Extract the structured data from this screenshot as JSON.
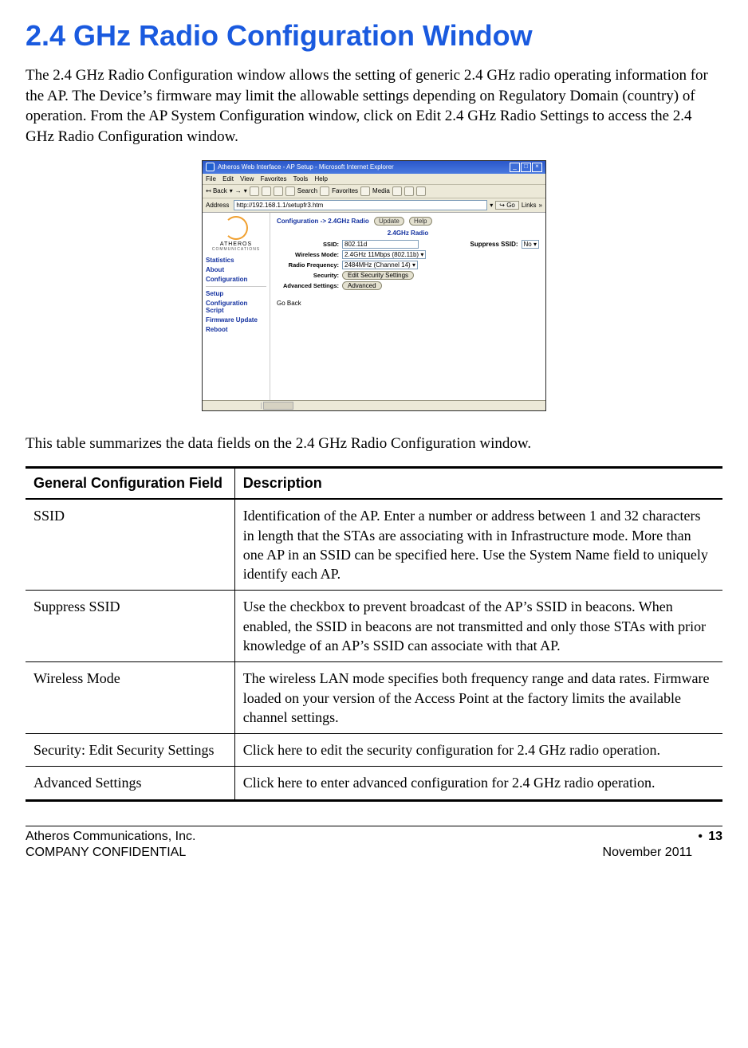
{
  "heading": "2.4 GHz Radio Configuration Window",
  "intro": "The 2.4 GHz Radio Configuration window allows the setting of generic 2.4 GHz radio operating information for the AP. The Device’s firmware may limit the allowable settings depending on Regulatory Domain (country) of operation. From the AP System Configuration window, click on Edit 2.4 GHz Radio Settings to access the 2.4 GHz Radio Configuration window.",
  "table_intro": "This table summarizes the data fields on the 2.4 GHz Radio Configuration window.",
  "table": {
    "headers": {
      "field": "General Configuration Field",
      "desc": "Description"
    },
    "rows": [
      {
        "field": "SSID",
        "desc": "Identification of the AP. Enter a number or address between 1 and 32 characters in length that the STAs are associating with in Infrastructure mode. More than one AP in an SSID can be specified here. Use the System Name field to uniquely identify each AP."
      },
      {
        "field": "Suppress SSID",
        "desc": "Use the checkbox to prevent broadcast of the AP’s SSID in beacons. When enabled, the SSID in beacons are not transmitted and only those STAs with prior knowledge of an AP’s SSID can associate with that AP."
      },
      {
        "field": "Wireless Mode",
        "desc": "The wireless LAN mode specifies both frequency range and data rates. Firmware loaded on your version of the Access Point at the factory limits the available channel settings."
      },
      {
        "field": "Security: Edit Security Settings",
        "desc": "Click here to edit the security configuration for 2.4 GHz radio operation."
      },
      {
        "field": "Advanced Settings",
        "desc": "Click here to enter advanced configuration for 2.4 GHz radio operation."
      }
    ]
  },
  "screenshot": {
    "window_title": "Atheros Web Interface - AP Setup - Microsoft Internet Explorer",
    "menu": [
      "File",
      "Edit",
      "View",
      "Favorites",
      "Tools",
      "Help"
    ],
    "toolbar_back": "Back",
    "toolbar_search": "Search",
    "toolbar_fav": "Favorites",
    "toolbar_media": "Media",
    "addr_label": "Address",
    "addr_url": "http://192.168.1.1/setupfr3.htm",
    "go": "Go",
    "links": "Links",
    "brand": "ATHEROS",
    "brand2": "COMMUNICATIONS",
    "side_links_top": [
      "Statistics",
      "About",
      "Configuration"
    ],
    "side_links_bottom": [
      "Setup",
      "Configuration Script",
      "Firmware Update",
      "Reboot"
    ],
    "crumb": "Configuration -> 2.4GHz Radio",
    "btn_update": "Update",
    "btn_help": "Help",
    "panel_title": "2.4GHz Radio",
    "fields": {
      "ssid_label": "SSID:",
      "ssid_value": "802.11d",
      "suppress_label": "Suppress SSID:",
      "suppress_value": "No",
      "mode_label": "Wireless Mode:",
      "mode_value": "2.4GHz 11Mbps (802.11b)",
      "freq_label": "Radio Frequency:",
      "freq_value": "2484MHz (Channel 14)",
      "sec_label": "Security:",
      "sec_btn": "Edit Security Settings",
      "adv_label": "Advanced Settings:",
      "adv_btn": "Advanced",
      "goback": "Go Back"
    }
  },
  "footer": {
    "company": "Atheros Communications, Inc.",
    "confidential": "COMPANY CONFIDENTIAL",
    "date": "November 2011",
    "bullet": "•",
    "page": "13"
  }
}
